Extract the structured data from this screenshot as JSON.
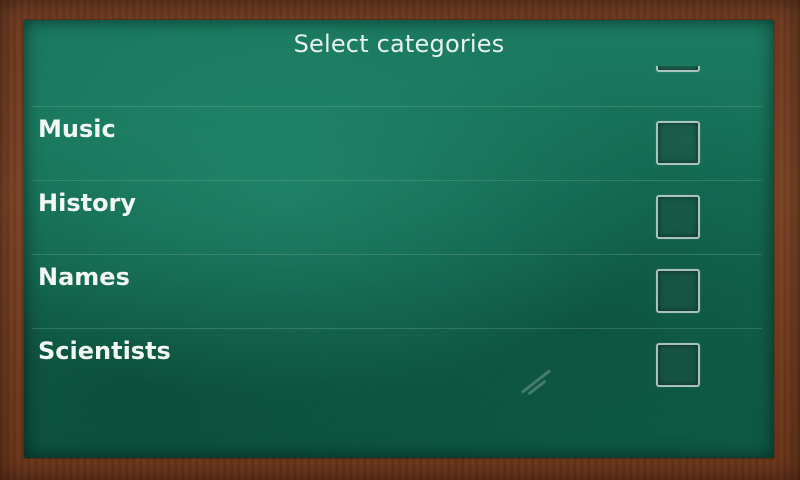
{
  "dialog": {
    "title": "Select categories"
  },
  "categories": [
    {
      "label": "",
      "checked": false
    },
    {
      "label": "Music",
      "checked": false
    },
    {
      "label": "History",
      "checked": false
    },
    {
      "label": "Names",
      "checked": false
    },
    {
      "label": "Scientists",
      "checked": false
    }
  ],
  "theme": {
    "board_color": "#157056",
    "frame_color": "#7d4526",
    "text_color": "#f2f7f4"
  }
}
